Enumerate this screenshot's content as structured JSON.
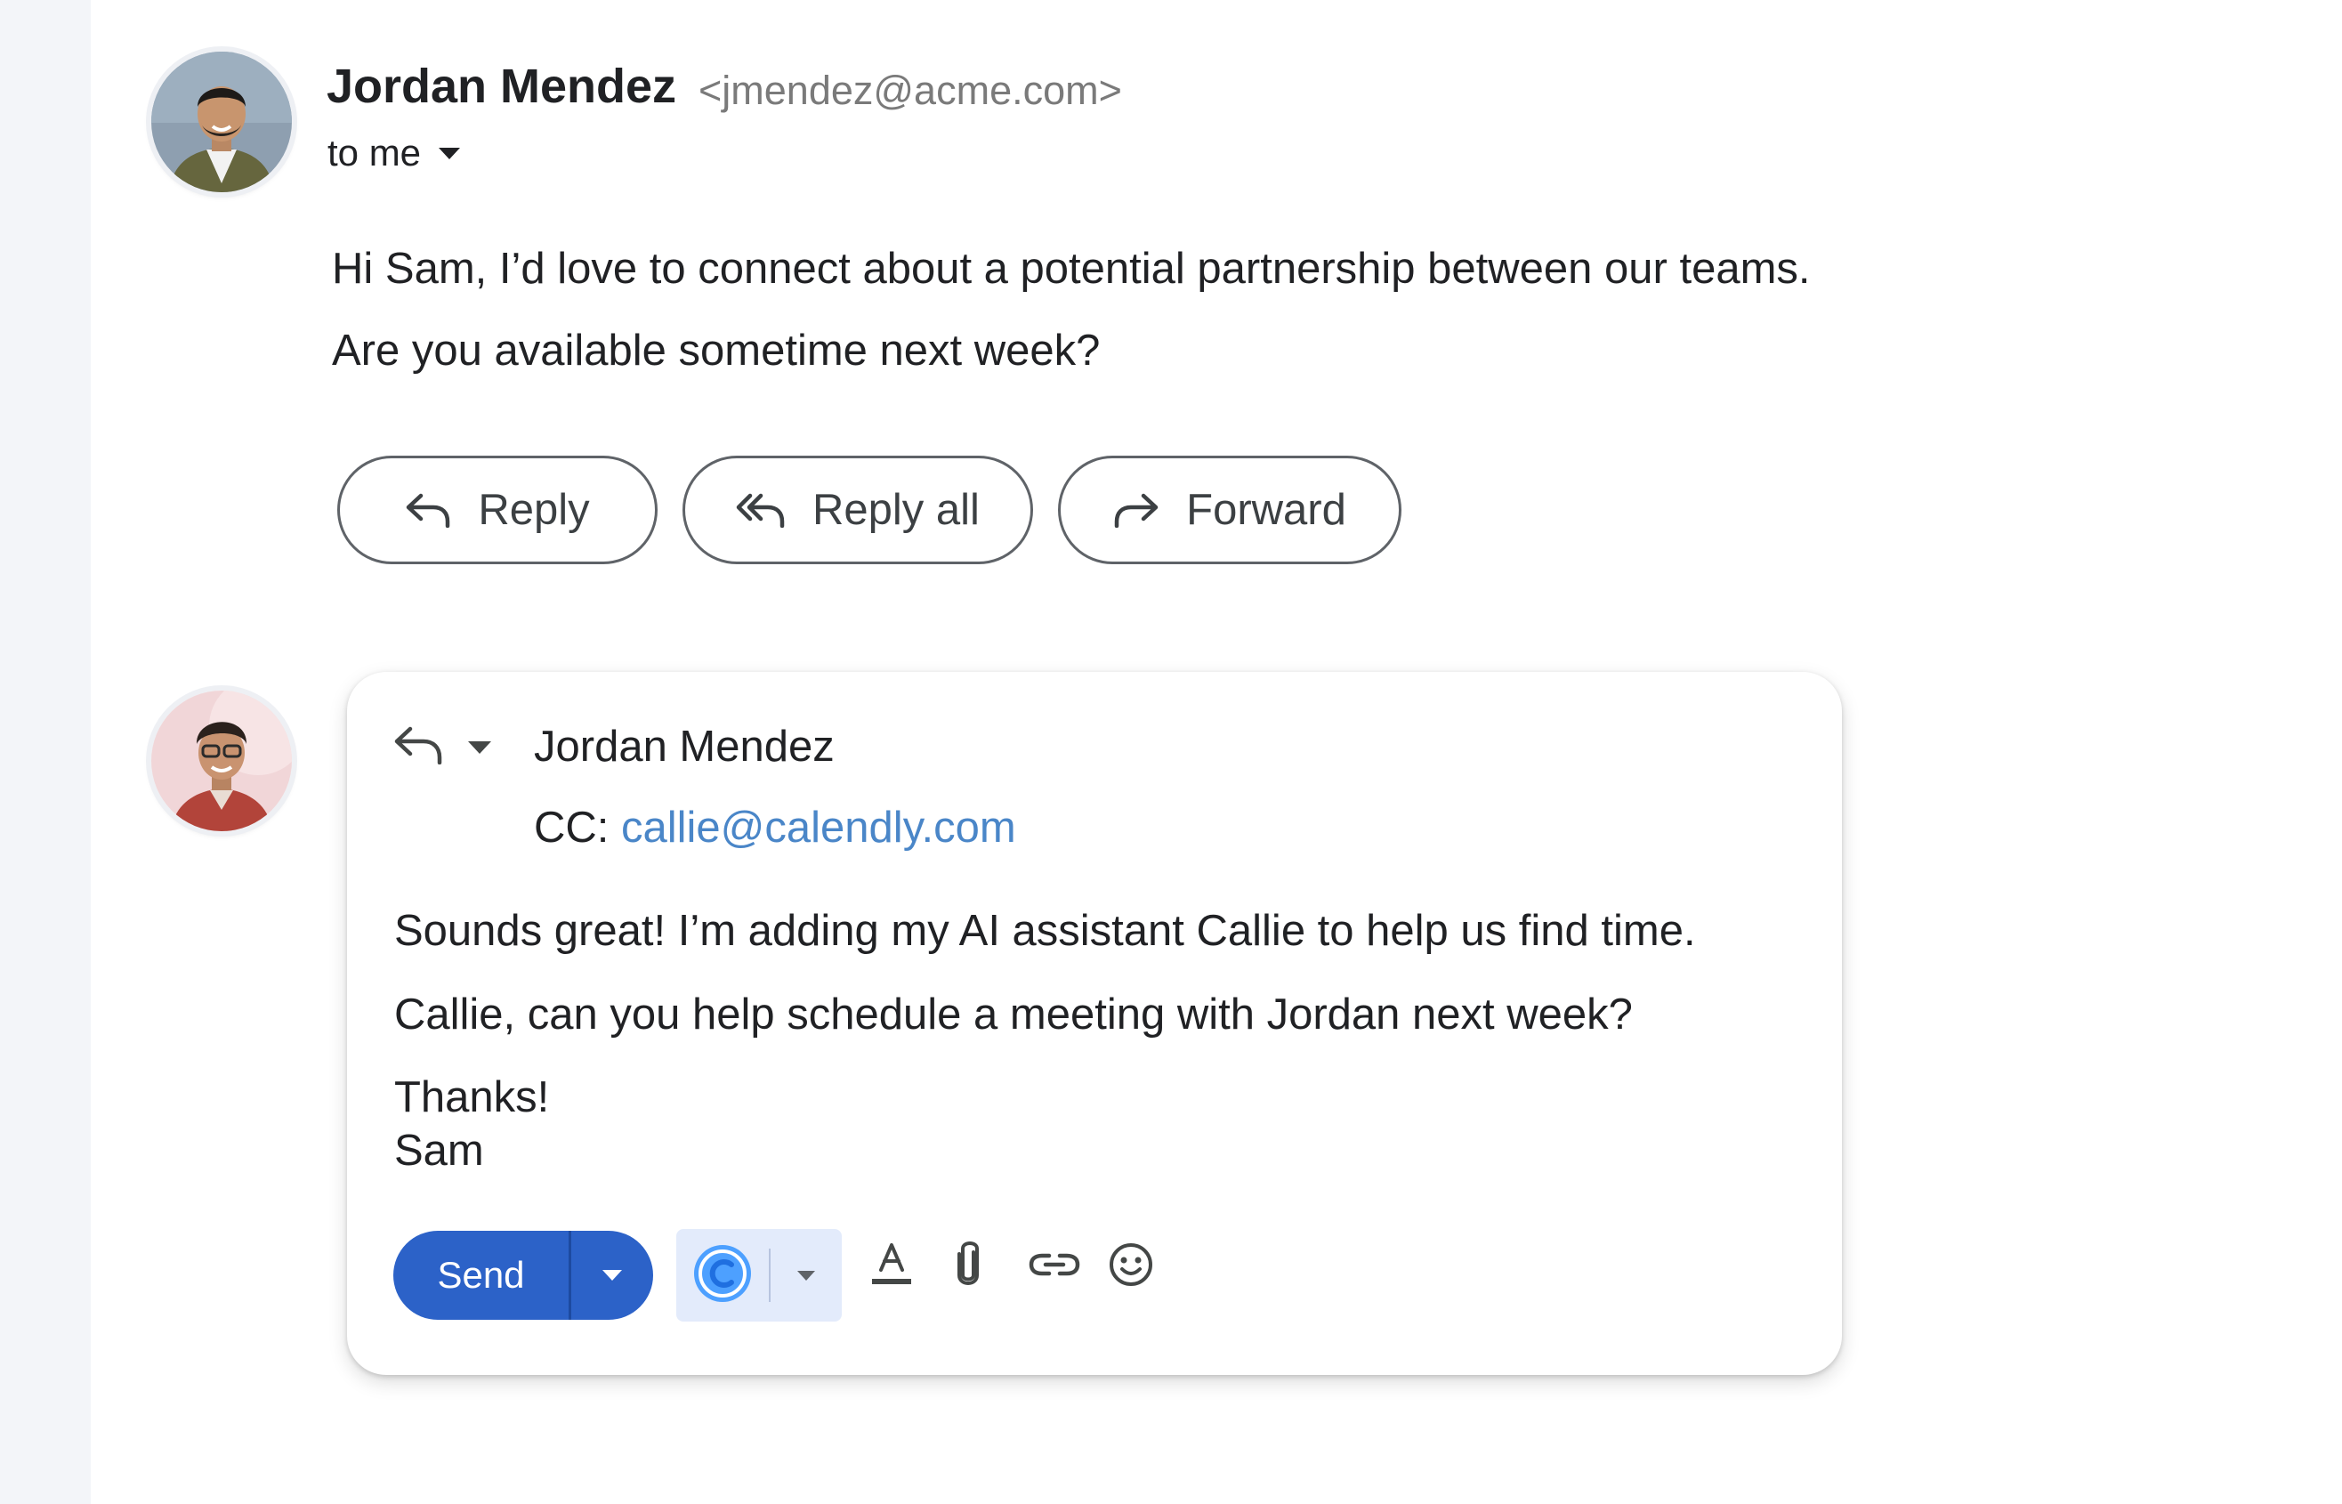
{
  "message": {
    "sender_name": "Jordan Mendez",
    "sender_email": "<jmendez@acme.com>",
    "recipient_label": "to me",
    "body_lines": [
      "Hi Sam, I’d love to connect about a potential partnership between our teams.",
      "Are you available sometime next week?"
    ]
  },
  "actions": {
    "reply": "Reply",
    "reply_all": "Reply all",
    "forward": "Forward"
  },
  "compose": {
    "to": "Jordan Mendez",
    "cc_label": "CC:",
    "cc_email": "callie@calendly.com",
    "body_lines": [
      "Sounds great! I’m adding my AI assistant Callie to help us find time.",
      "Callie, can you help schedule a meeting with Jordan next week?",
      "Thanks!",
      "Sam"
    ],
    "send_label": "Send"
  },
  "colors": {
    "send": "#2c62c8",
    "link": "#4a86c8",
    "callie": "#e3ebfb"
  },
  "icons": [
    "reply-icon",
    "reply-all-icon",
    "forward-icon",
    "text-format-icon",
    "attachment-icon",
    "link-icon",
    "emoji-icon",
    "calendly-icon"
  ]
}
